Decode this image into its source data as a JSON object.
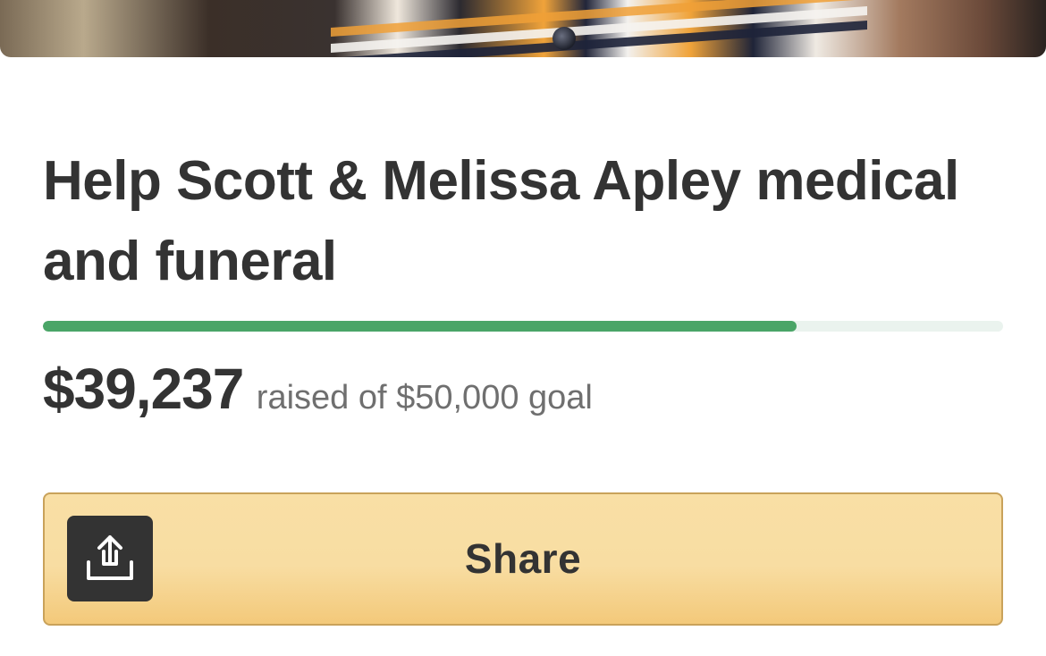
{
  "campaign": {
    "title": "Help Scott & Melissa Apley medical and funeral",
    "progress_fraction": 0.785,
    "amount_raised": "$39,237",
    "goal_text": "raised of $50,000 goal"
  },
  "share": {
    "label": "Share",
    "icon": "share-upload-icon"
  },
  "colors": {
    "progress_fill": "#4aa567",
    "progress_track": "#eaf3ee",
    "share_button_bg": "#f8dda2",
    "share_button_border": "#c9a25a",
    "text_dark": "#333333",
    "text_muted": "#6f6f6f"
  }
}
